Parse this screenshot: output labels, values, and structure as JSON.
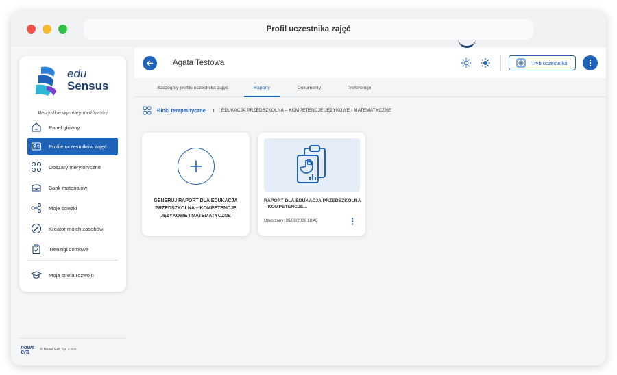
{
  "window": {
    "title": "Profil uczestnika zajęć"
  },
  "brand": {
    "logo_line1": "edu",
    "logo_line2": "Sensus",
    "tagline": "Wszystkie wymiary możliwości",
    "footer_logo_line1": "nowa",
    "footer_logo_line2": "era",
    "footer_text": "© Nowa Era Sp. z o.o."
  },
  "sidebar": {
    "items": [
      {
        "label": "Panel główny",
        "icon": "home-icon"
      },
      {
        "label": "Profile uczestników zajęć",
        "icon": "id-card-icon",
        "active": true
      },
      {
        "label": "Obszary merytoryczne",
        "icon": "grid-icon"
      },
      {
        "label": "Bank materiałów",
        "icon": "archive-icon"
      },
      {
        "label": "Moje ścieżki",
        "icon": "share-nodes-icon"
      },
      {
        "label": "Kreator moich zasobów",
        "icon": "brush-icon"
      },
      {
        "label": "Treningi domowe",
        "icon": "checklist-icon"
      },
      {
        "label": "Moja strefa rozwoju",
        "icon": "graduation-cap-icon"
      }
    ]
  },
  "header": {
    "participant_name": "Agata Testowa",
    "mode_button_label": "Tryb uczestnika"
  },
  "tabs": [
    {
      "label": "Szczegóły profilu uczestnika zajęć"
    },
    {
      "label": "Raporty",
      "active": true
    },
    {
      "label": "Dokumenty"
    },
    {
      "label": "Preferencje"
    }
  ],
  "breadcrumb": {
    "root": "Bloki terapeutyczne",
    "current": "EDUKACJA PRZEDSZKOLNA – KOMPETENCJE JĘZYKOWE I MATEMATYCZNE"
  },
  "cards": {
    "generate": {
      "text": "GENERUJ RAPORT DLA EDUKACJA PRZEDSZKOLNA – KOMPETENCJE JĘZYKOWE I MATEMATYCZNE"
    },
    "report": {
      "title": "RAPORT DLA EDUKACJA PRZEDSZKOLNA – KOMPETENCJE...",
      "created": "Utworzony: 05/08/2026 18:46"
    }
  },
  "colors": {
    "accent": "#1f63b8",
    "brand_dark": "#1a3b6e",
    "thumb_bg": "#e5edf8"
  }
}
